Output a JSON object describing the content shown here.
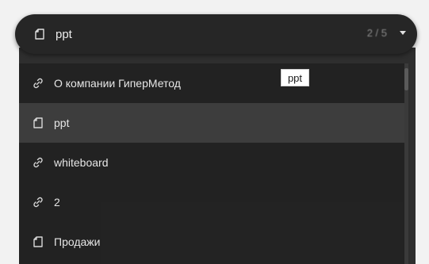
{
  "search": {
    "query": "ppt",
    "counter": "2 / 5",
    "icon": "file-icon"
  },
  "tooltip": "ppt",
  "menu": {
    "items": [
      {
        "label": "О компании ГиперМетод",
        "icon": "link-icon",
        "selected": false
      },
      {
        "label": "ppt",
        "icon": "file-icon",
        "selected": true
      },
      {
        "label": "whiteboard",
        "icon": "link-icon",
        "selected": false
      },
      {
        "label": "2",
        "icon": "link-icon",
        "selected": false
      },
      {
        "label": "Продажи",
        "icon": "file-icon",
        "selected": false
      }
    ]
  },
  "colors": {
    "menu_background": "#222222",
    "selected_background": "#3d3d3d",
    "text": "#e6e6e6",
    "searchbar": "#262626",
    "page_background": "#f2f2f2"
  }
}
